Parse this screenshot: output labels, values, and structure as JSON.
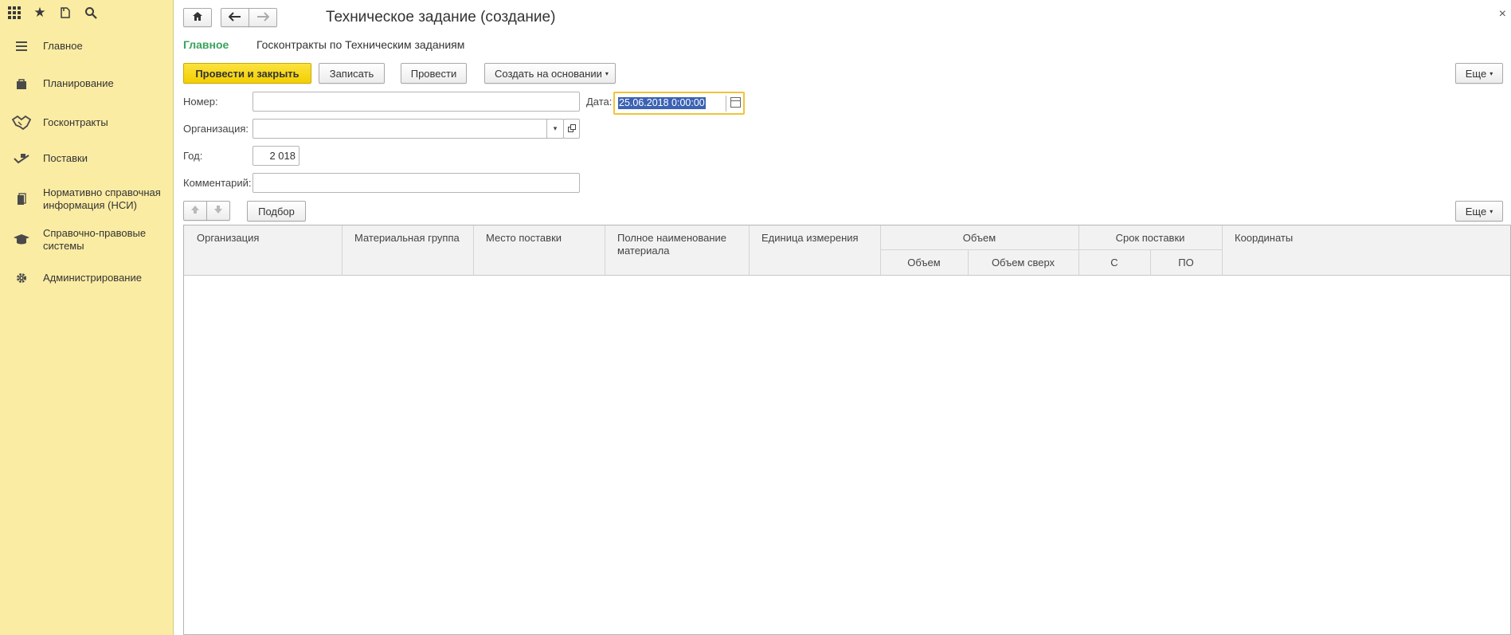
{
  "sidebar": {
    "top_icons": [
      "apps-grid-icon",
      "star-icon",
      "history-icon",
      "search-icon"
    ],
    "items": [
      {
        "label": "Главное",
        "icon": "menu-lines-icon"
      },
      {
        "label": "Планирование",
        "icon": "bag-icon"
      },
      {
        "label": "Госконтракты",
        "icon": "handshake-icon"
      },
      {
        "label": "Поставки",
        "icon": "delivery-icon"
      },
      {
        "label": "Нормативно справочная информация (НСИ)",
        "icon": "books-icon"
      },
      {
        "label": "Справочно-правовые системы",
        "icon": "graduation-cap-icon"
      },
      {
        "label": "Администрирование",
        "icon": "gear-icon"
      }
    ]
  },
  "header": {
    "title": "Техническое задание (создание)",
    "close_label": "×"
  },
  "tabs": {
    "main": "Главное",
    "link": "Госконтракты по Техническим заданиям"
  },
  "toolbar": {
    "post_close": "Провести и закрыть",
    "save": "Записать",
    "post": "Провести",
    "create_based": "Создать на основании",
    "more": "Еще"
  },
  "form": {
    "number_label": "Номер:",
    "number_value": "",
    "date_label": "Дата:",
    "date_value": "25.06.2018  0:00:00",
    "org_label": "Организация:",
    "org_value": "",
    "year_label": "Год:",
    "year_value": "2 018",
    "comment_label": "Комментарий:",
    "comment_value": ""
  },
  "table_toolbar": {
    "pick": "Подбор",
    "more": "Еще"
  },
  "table": {
    "columns": {
      "org": "Организация",
      "mat_group": "Материальная группа",
      "place": "Место поставки",
      "full_name": "Полное наименование материала",
      "unit": "Единица измерения",
      "volume": "Объем",
      "volume_sub": "Объем",
      "volume_over": "Объем сверх",
      "term": "Срок поставки",
      "term_from": "С",
      "term_to": "ПО",
      "coords": "Координаты"
    },
    "rows": []
  },
  "colors": {
    "sidebar_bg": "#fbeca3",
    "primary_button": "#f3cf00",
    "tab_active": "#3aa35a",
    "date_focus": "#f0c43a",
    "selection": "#3b62b3"
  }
}
